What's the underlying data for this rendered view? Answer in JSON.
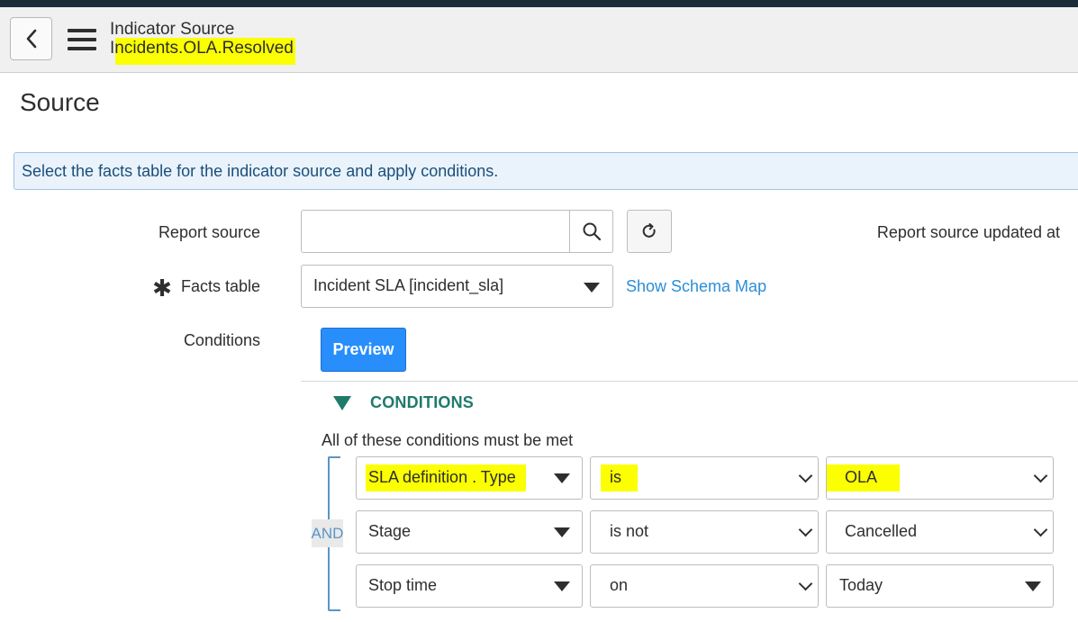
{
  "header": {
    "title": "Indicator Source",
    "record_name": "Incidents.OLA.Resolved",
    "back_icon": "chevron-left-icon",
    "menu_icon": "hamburger-menu-icon"
  },
  "section": {
    "title": "Source"
  },
  "info_message": "Select the facts table for the indicator source and apply conditions.",
  "form": {
    "report_source": {
      "label": "Report source",
      "value": "",
      "search_icon": "search-icon",
      "refresh_icon": "refresh-icon",
      "updated_label": "Report source updated at"
    },
    "facts_table": {
      "required_marker": "✱",
      "label": "Facts table",
      "value": "Incident SLA [incident_sla]",
      "schema_link": "Show Schema Map"
    },
    "conditions": {
      "label": "Conditions",
      "preview_button": "Preview"
    }
  },
  "condition_builder": {
    "heading": "CONDITIONS",
    "description": "All of these conditions must be met",
    "operator_badge": "AND",
    "rows": [
      {
        "field": "SLA definition . Type",
        "operator": "is",
        "value": "OLA"
      },
      {
        "field": "Stage",
        "operator": "is not",
        "value": "Cancelled"
      },
      {
        "field": "Stop time",
        "operator": "on",
        "value": "Today"
      }
    ]
  },
  "colors": {
    "accent_blue": "#278efc",
    "link_blue": "#2b8ed6",
    "conditions_green": "#1f7a6b",
    "highlight_yellow": "#fbff00"
  }
}
